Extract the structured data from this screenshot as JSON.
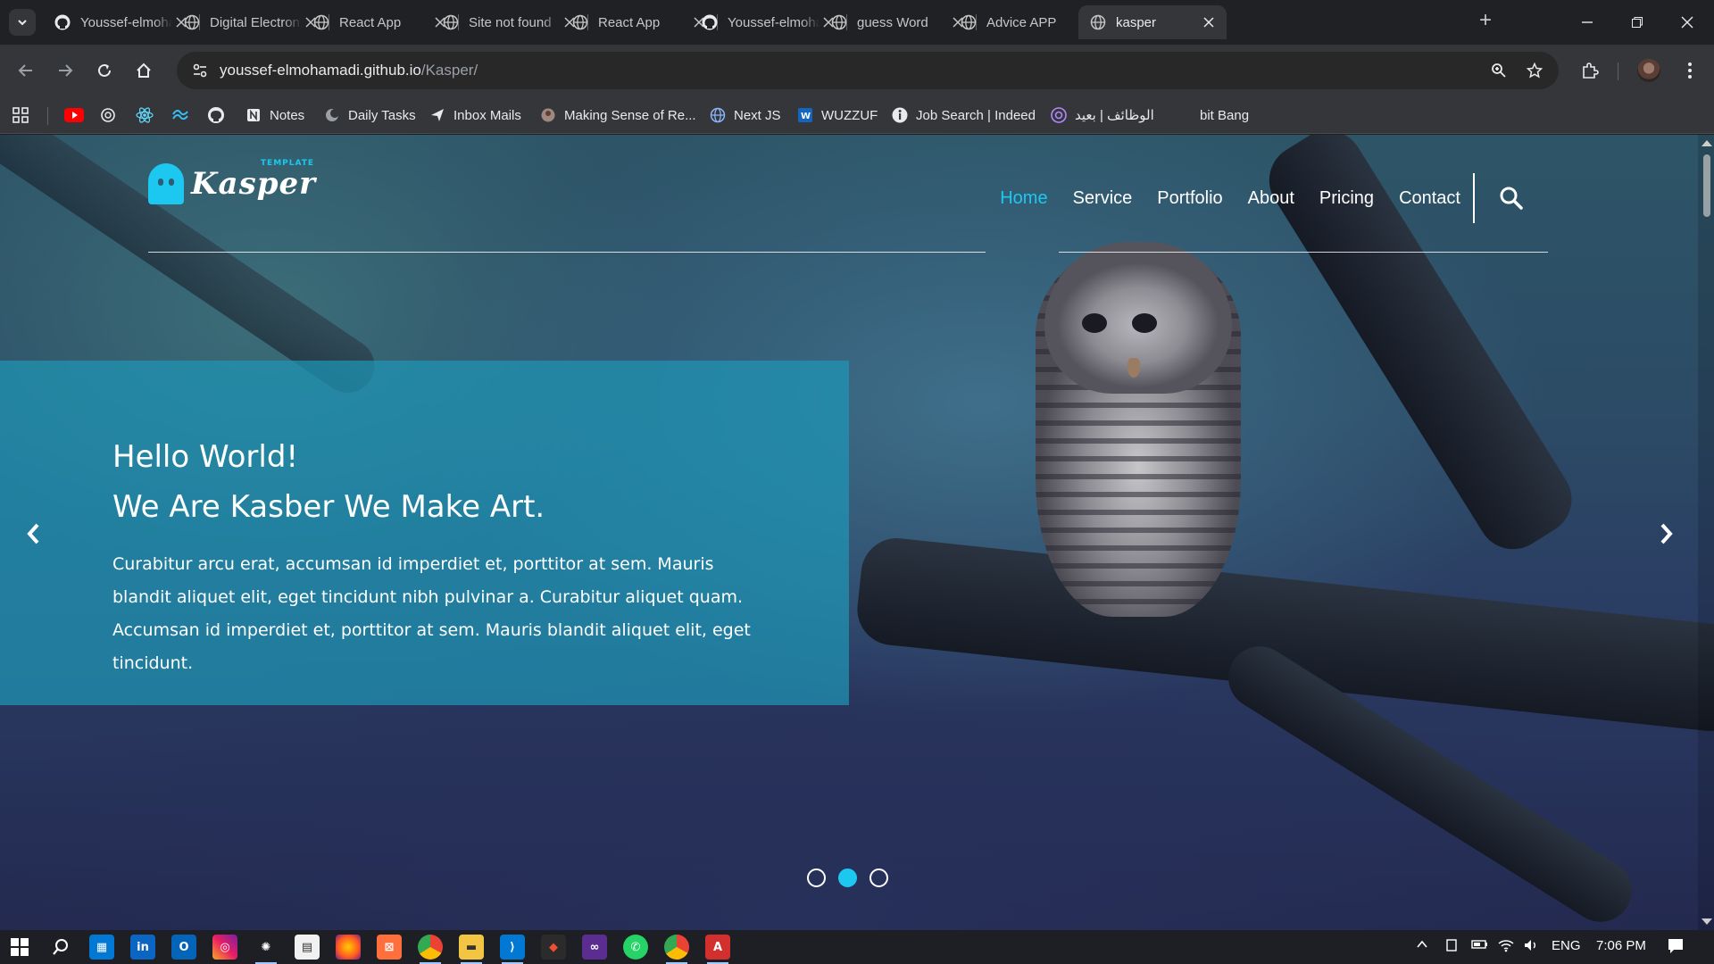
{
  "browser": {
    "tabs": [
      {
        "title": "Youssef-elmohamadi",
        "icon": "github-icon"
      },
      {
        "title": "Digital Electronics",
        "icon": "globe-icon"
      },
      {
        "title": "React App",
        "icon": "globe-icon"
      },
      {
        "title": "Site not found",
        "icon": "globe-icon"
      },
      {
        "title": "React App",
        "icon": "globe-icon"
      },
      {
        "title": "Youssef-elmohamadi",
        "icon": "github-icon"
      },
      {
        "title": "guess Word",
        "icon": "globe-icon"
      },
      {
        "title": "Advice APP",
        "icon": "globe-icon"
      },
      {
        "title": "kasper",
        "icon": "globe-icon",
        "active": true
      }
    ],
    "new_tab": "+",
    "url_host": "youssef-elmohamadi.github.io",
    "url_path": "/Kasper/",
    "bookmarks": [
      {
        "label": "Notes",
        "icon": "notion-icon"
      },
      {
        "label": "Daily Tasks",
        "icon": "moon-icon"
      },
      {
        "label": "Inbox Mails",
        "icon": "send-icon"
      },
      {
        "label": "Making Sense of Re...",
        "icon": "avatar-icon"
      },
      {
        "label": "Next JS",
        "icon": "globe-icon"
      },
      {
        "label": "WUZZUF",
        "icon": "wuzzuf-icon"
      },
      {
        "label": "Job Search | Indeed",
        "icon": "indeed-icon"
      },
      {
        "label": "الوظائف | بعيد",
        "icon": "remote-icon"
      },
      {
        "label": "bit Bang",
        "icon": "blank-icon"
      }
    ],
    "icon_only_bookmarks": [
      "youtube-icon",
      "chatgpt-icon",
      "react-icon",
      "tailwind-icon",
      "github-icon"
    ]
  },
  "site": {
    "logo_text": "Kasper",
    "logo_sub": "TEMPLATE",
    "nav": [
      "Home",
      "Service",
      "Portfolio",
      "About",
      "Pricing",
      "Contact"
    ],
    "active_nav": "Home",
    "hero": {
      "line1": "Hello World!",
      "line2": "We Are Kasber We Make Art.",
      "body": "Curabitur arcu erat, accumsan id imperdiet et, porttitor at sem. Mauris blandit aliquet elit, eget tincidunt nibh pulvinar a. Curabitur aliquet quam. Accumsan id imperdiet et, porttitor at sem. Mauris blandit aliquet elit, eget tincidunt."
    },
    "slides": 3,
    "active_slide": 2,
    "accent": "#1dc8f0"
  },
  "taskbar": {
    "lang": "ENG",
    "time": "7:06 PM"
  }
}
